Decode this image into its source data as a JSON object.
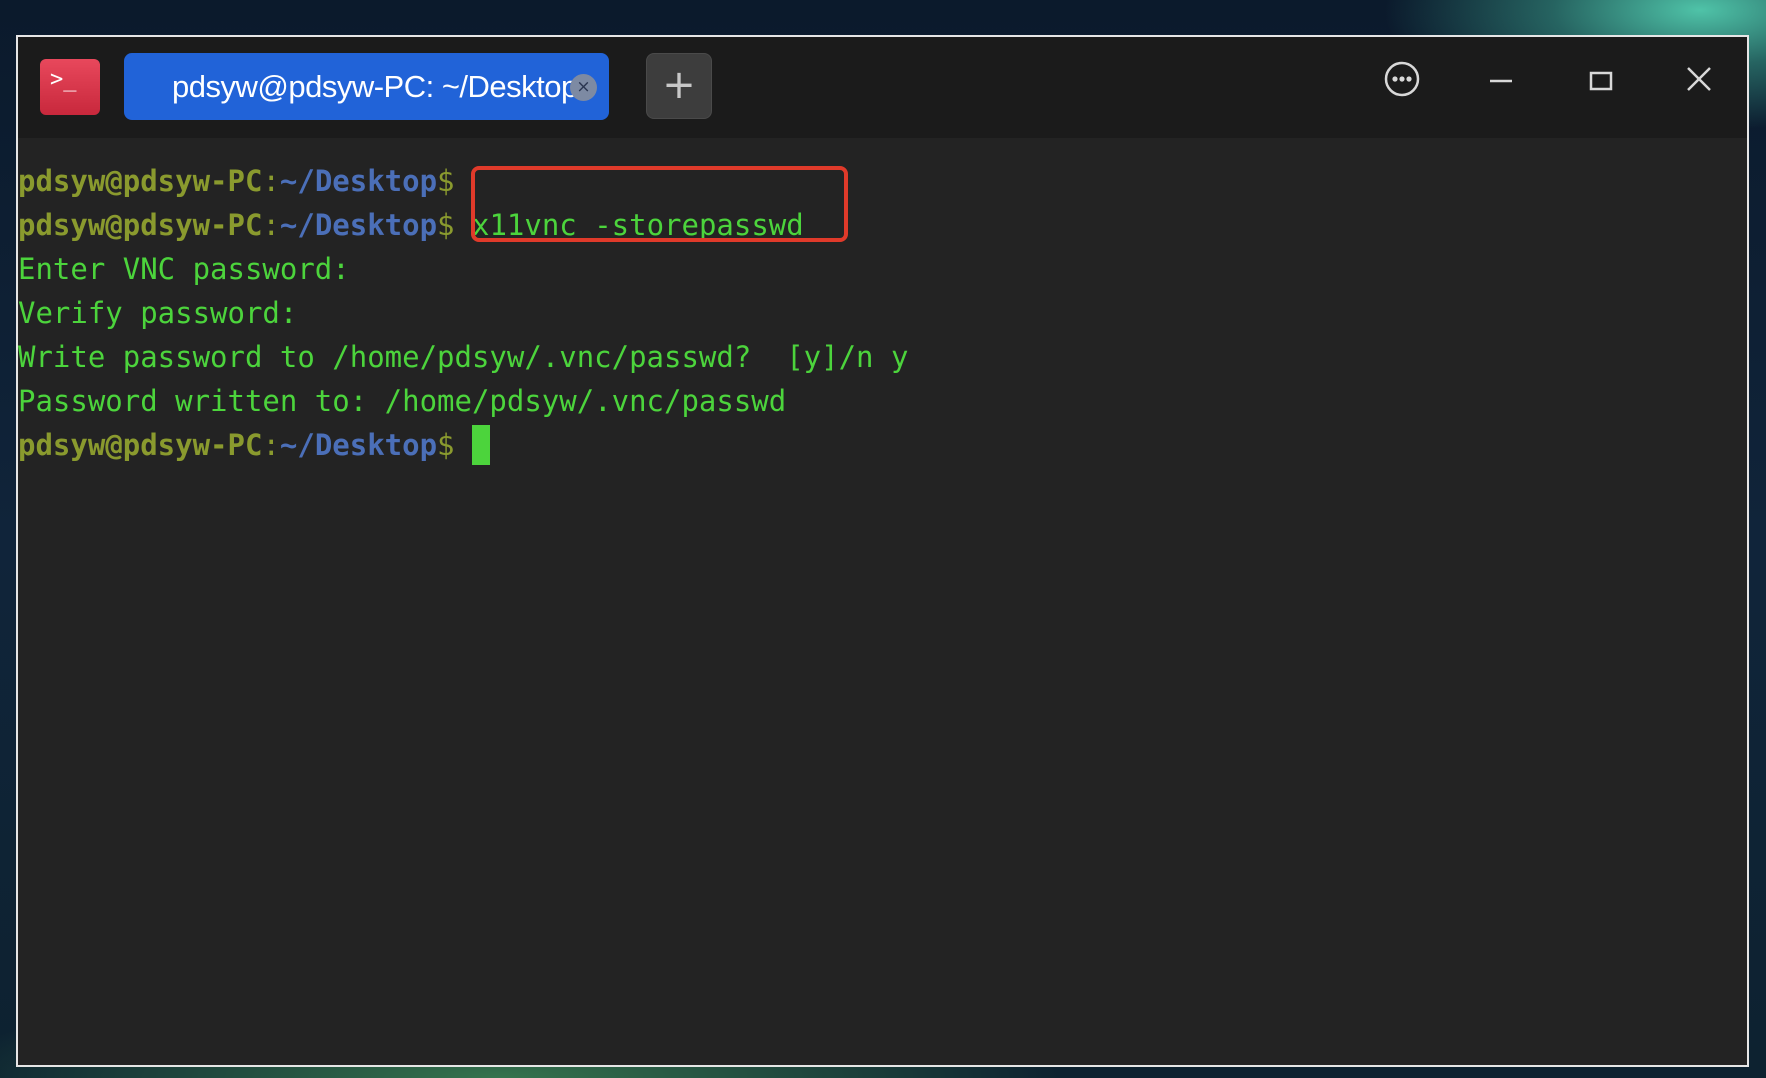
{
  "window": {
    "app_icon_glyph": ">_",
    "tab_title": "pdsyw@pdsyw-PC: ~/Desktop",
    "tab_close_glyph": "×",
    "new_tab_glyph": "+",
    "controls": {
      "menu_icon": "more-options-icon",
      "minimize_icon": "minimize-icon",
      "maximize_icon": "maximize-icon",
      "close_icon": "close-icon"
    }
  },
  "terminal": {
    "prompt": {
      "user_host": "pdsyw@pdsyw-PC",
      "colon": ":",
      "path": "~/Desktop",
      "dollar": "$"
    },
    "command": "x11vnc -storepasswd",
    "output": [
      "Enter VNC password:",
      "Verify password:",
      "Write password to /home/pdsyw/.vnc/passwd?  [y]/n y",
      "Password written to: /home/pdsyw/.vnc/passwd"
    ]
  },
  "colors": {
    "terminal_bg": "#232323",
    "text_green": "#4cd43c",
    "prompt_user": "#8a9a2e",
    "prompt_path": "#4b6fb8",
    "tab_active": "#2163d8",
    "highlight_box": "#e03a2a"
  }
}
